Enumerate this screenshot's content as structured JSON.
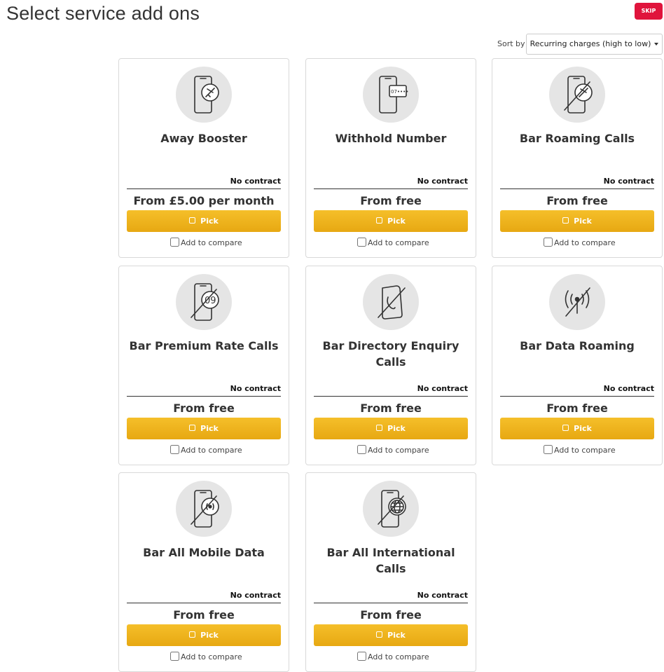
{
  "page": {
    "title": "Select service add ons",
    "skip_label": "SKIP"
  },
  "sort": {
    "label": "Sort by",
    "selected": "Recurring charges (high to low)"
  },
  "cards": [
    {
      "icon": "phone-plane-icon",
      "title": "Away Booster",
      "contract": "No contract",
      "price": "From £5.00 per month",
      "pick_label": "Pick",
      "compare_label": "Add to compare"
    },
    {
      "icon": "phone-number-icon",
      "title": "Withhold Number",
      "contract": "No contract",
      "price": "From free",
      "pick_label": "Pick",
      "compare_label": "Add to compare"
    },
    {
      "icon": "phone-no-roaming-icon",
      "title": "Bar Roaming Calls",
      "contract": "No contract",
      "price": "From free",
      "pick_label": "Pick",
      "compare_label": "Add to compare"
    },
    {
      "icon": "phone-no-premium-icon",
      "title": "Bar Premium Rate Calls",
      "contract": "No contract",
      "price": "From free",
      "pick_label": "Pick",
      "compare_label": "Add to compare"
    },
    {
      "icon": "directory-barred-icon",
      "title": "Bar Directory Enquiry Calls",
      "contract": "No contract",
      "price": "From free",
      "pick_label": "Pick",
      "compare_label": "Add to compare"
    },
    {
      "icon": "signal-barred-icon",
      "title": "Bar Data Roaming",
      "contract": "No contract",
      "price": "From free",
      "pick_label": "Pick",
      "compare_label": "Add to compare"
    },
    {
      "icon": "phone-no-data-icon",
      "title": "Bar All Mobile Data",
      "contract": "No contract",
      "price": "From free",
      "pick_label": "Pick",
      "compare_label": "Add to compare"
    },
    {
      "icon": "phone-no-international-icon",
      "title": "Bar All International Calls",
      "contract": "No contract",
      "price": "From free",
      "pick_label": "Pick",
      "compare_label": "Add to compare"
    }
  ]
}
